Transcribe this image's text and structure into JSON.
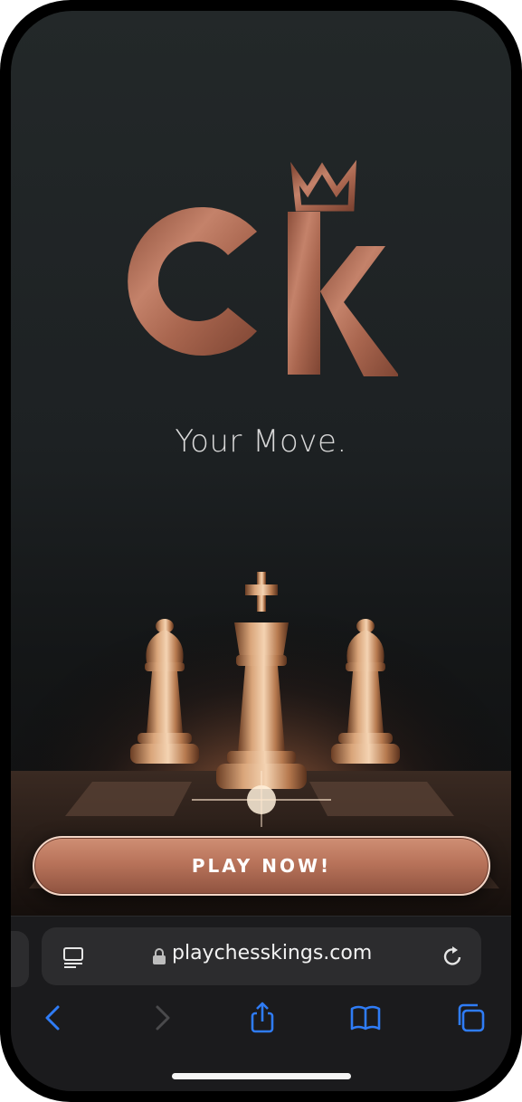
{
  "brand": {
    "logo_text": "CK",
    "accent": "#c17e63",
    "accent_dark": "#7e4533"
  },
  "hero": {
    "tagline": "Your Move.",
    "cta_label": "PLAY NOW!"
  },
  "browser": {
    "url": "playchesskings.com",
    "icons": {
      "reader": "reader-icon",
      "lock": "lock-icon",
      "reload": "reload-icon",
      "back": "back-icon",
      "forward": "forward-icon",
      "share": "share-icon",
      "bookmarks": "bookmarks-icon",
      "tabs": "tabs-icon"
    },
    "tint": "#2f7cf6"
  }
}
